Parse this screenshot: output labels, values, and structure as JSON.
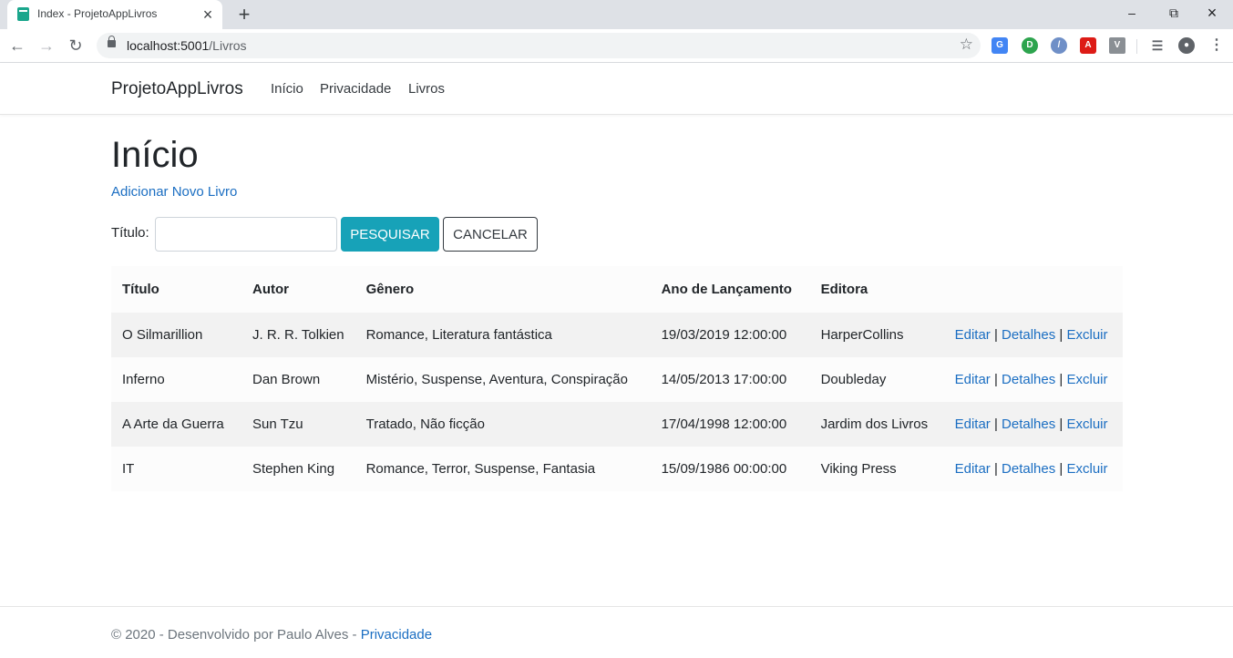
{
  "browser": {
    "tab_title": "Index - ProjetoAppLivros",
    "url_host": "localhost:5001",
    "url_path": "/Livros"
  },
  "navbar": {
    "brand": "ProjetoAppLivros",
    "links": [
      "Início",
      "Privacidade",
      "Livros"
    ]
  },
  "page": {
    "heading": "Início",
    "add_link": "Adicionar Novo Livro"
  },
  "search": {
    "label": "Título:",
    "value": "",
    "search_button": "PESQUISAR",
    "cancel_button": "CANCELAR"
  },
  "table": {
    "headers": [
      "Título",
      "Autor",
      "Gênero",
      "Ano de Lançamento",
      "Editora",
      ""
    ],
    "rows": [
      {
        "titulo": "O Silmarillion",
        "autor": "J. R. R. Tolkien",
        "genero": "Romance, Literatura fantástica",
        "ano": "19/03/2019 12:00:00",
        "editora": "HarperCollins"
      },
      {
        "titulo": "Inferno",
        "autor": "Dan Brown",
        "genero": "Mistério, Suspense, Aventura, Conspiração",
        "ano": "14/05/2013 17:00:00",
        "editora": "Doubleday"
      },
      {
        "titulo": "A Arte da Guerra",
        "autor": "Sun Tzu",
        "genero": "Tratado, Não ficção",
        "ano": "17/04/1998 12:00:00",
        "editora": "Jardim dos Livros"
      },
      {
        "titulo": "IT",
        "autor": "Stephen King",
        "genero": "Romance, Terror, Suspense, Fantasia",
        "ano": "15/09/1986 00:00:00",
        "editora": "Viking Press"
      }
    ],
    "actions": {
      "edit": "Editar",
      "details": "Detalhes",
      "delete": "Excluir",
      "separator": "|"
    }
  },
  "footer": {
    "text": "© 2020 - Desenvolvido por Paulo Alves - ",
    "link": "Privacidade"
  },
  "colors": {
    "link": "#1b6ec2",
    "search_button": "#17a2b8",
    "favicon": "#1aa68c"
  }
}
